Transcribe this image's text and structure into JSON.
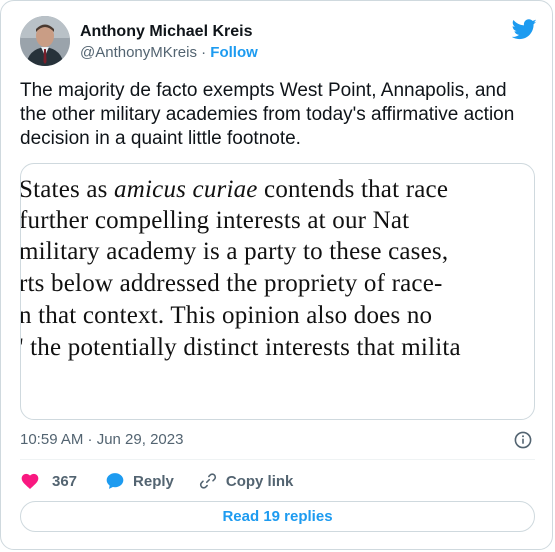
{
  "author": {
    "name": "Anthony Michael Kreis",
    "handle": "@AnthonyMKreis",
    "separator": "·",
    "follow_label": "Follow"
  },
  "icons": {
    "brand": "twitter-bird-icon",
    "info": "info-icon",
    "like": "heart-icon",
    "reply": "speech-bubble-icon",
    "copy": "link-icon"
  },
  "colors": {
    "accent": "#1d9bf0",
    "like": "#f91880",
    "muted": "#536471"
  },
  "tweet": {
    "text": "The majority de facto exempts West Point, Annapolis, and the other military academies from today's affirmative action decision in a quaint little footnote."
  },
  "media": {
    "lines": [
      {
        "before": "States as ",
        "italic": "amicus curiae",
        "after": " contends that race"
      },
      {
        "before": " further compelling interests at our Nat",
        "italic": "",
        "after": ""
      },
      {
        "before": "military academy is a party to these cases,",
        "italic": "",
        "after": ""
      },
      {
        "before": "rts below addressed the propriety of race-",
        "italic": "",
        "after": ""
      },
      {
        "before": "n that context.  This opinion also does no",
        "italic": "",
        "after": ""
      },
      {
        "before": "' the potentially distinct interests that milita",
        "italic": "",
        "after": ""
      }
    ]
  },
  "meta": {
    "timestamp": "10:59 AM · Jun 29, 2023"
  },
  "actions": {
    "like_count": "367",
    "reply_label": "Reply",
    "copy_label": "Copy link"
  },
  "read_replies_label": "Read 19 replies"
}
